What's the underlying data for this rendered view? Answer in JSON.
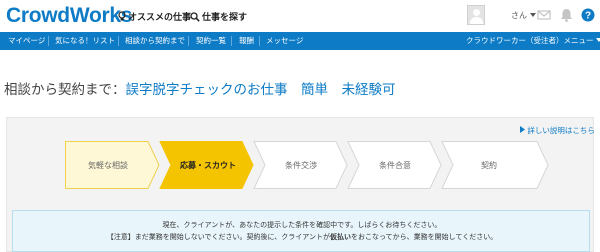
{
  "header": {
    "logo": "CrowdWorks",
    "recommended": "オススメの仕事",
    "search_jobs": "仕事を探す",
    "user_suffix": "さん"
  },
  "nav": {
    "items": [
      "マイページ",
      "気になる！リスト",
      "相談から契約まで",
      "契約一覧",
      "報酬",
      "メッセージ"
    ],
    "role_menu": "クラウドワーカー（受注者）メニュー"
  },
  "page": {
    "title_prefix": "相談から契約まで：",
    "job_title": "誤字脱字チェックのお仕事　簡単　未経験可"
  },
  "details_link": "詳しい説明はこちら",
  "steps": [
    {
      "label": "気軽な相談"
    },
    {
      "label": "応募・スカウト"
    },
    {
      "label": "条件交渉"
    },
    {
      "label": "条件合意"
    },
    {
      "label": "契約"
    }
  ],
  "notice": {
    "line1": "現在、クライアントが、あなたの提示した条件を確認中です。しばらくお待ちください。",
    "line2_prefix": "【注意】まだ業務を開始しないでください。契約後に、クライアントが",
    "line2_emph": "仮払い",
    "line2_suffix": "をおこなってから、業務を開始してください。"
  },
  "colors": {
    "brand_blue": "#0d7bc6",
    "step_done": "#fff8d6",
    "step_active": "#f5c400",
    "help_icon": "#0d7bc6"
  },
  "icons": {
    "recommended": "lightbulb-icon",
    "search": "search-icon",
    "caret": "caret-down-icon",
    "message": "envelope-icon",
    "notification": "bell-icon",
    "help": "question-icon"
  }
}
